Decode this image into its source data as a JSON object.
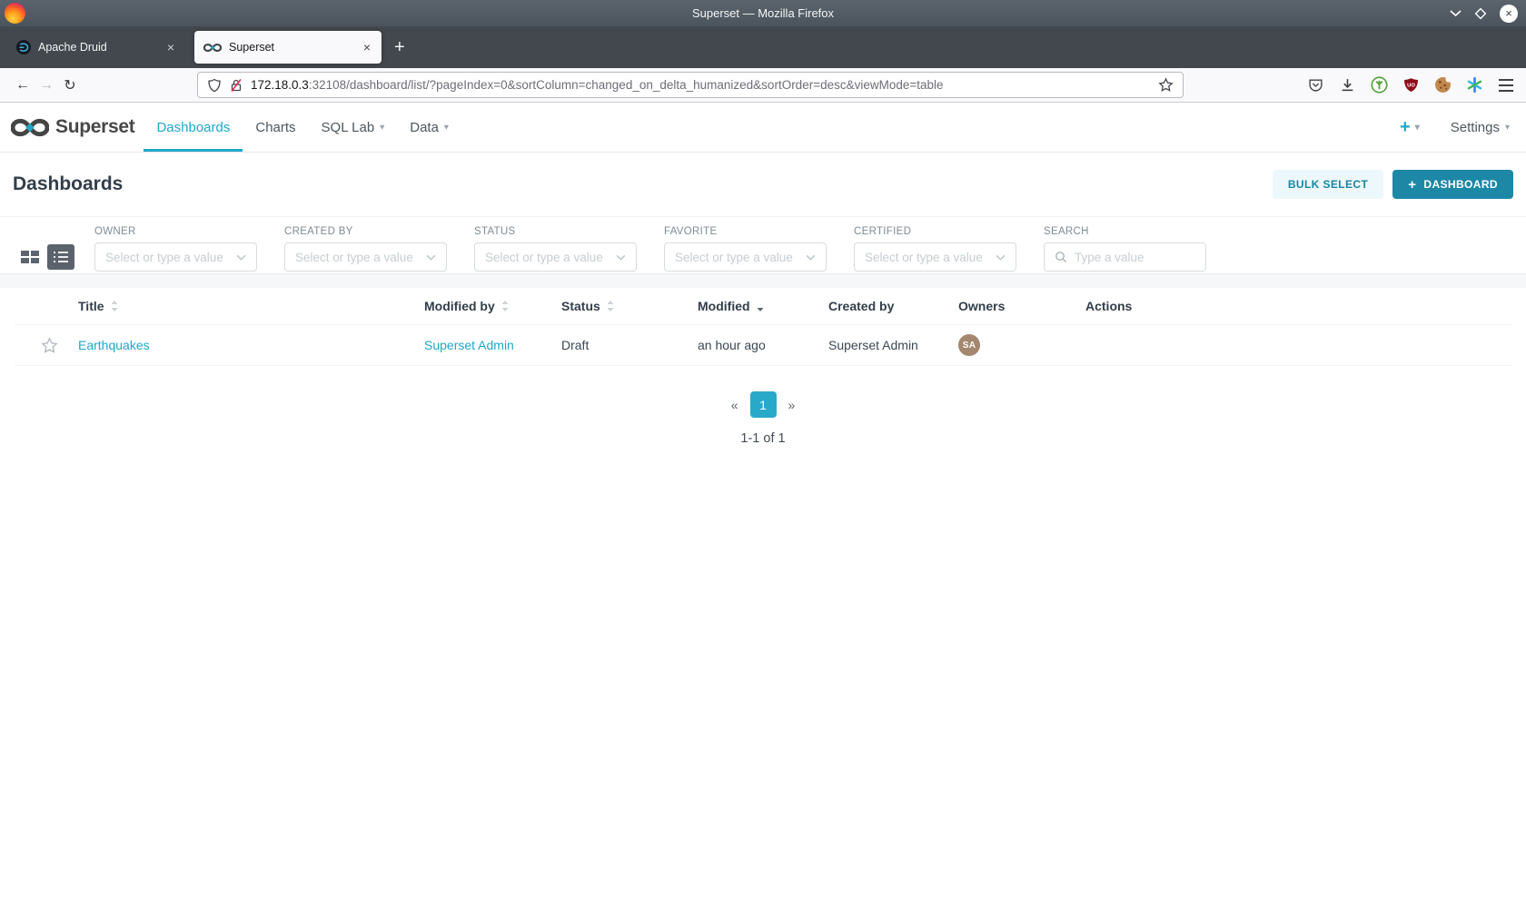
{
  "colors": {
    "accent": "#20a7c9",
    "button_primary": "#1d88a6",
    "avatar": "#a3876e"
  },
  "glyphs": {
    "close": "×",
    "new_tab": "+",
    "back": "←",
    "forward": "→",
    "reload": "↻",
    "caret": "▾",
    "plus": "+",
    "prev": "«",
    "next": "»",
    "ublock": "UO"
  },
  "titlebar": {
    "title": "Superset — Mozilla Firefox"
  },
  "tabs": [
    {
      "label": "Apache Druid"
    },
    {
      "label": "Superset"
    }
  ],
  "urlbar": {
    "host": "172.18.0.3",
    "path": ":32108/dashboard/list/?pageIndex=0&sortColumn=changed_on_delta_humanized&sortOrder=desc&viewMode=table"
  },
  "navbar": {
    "brand": "Superset",
    "items": [
      {
        "label": "Dashboards"
      },
      {
        "label": "Charts"
      },
      {
        "label": "SQL Lab"
      },
      {
        "label": "Data"
      }
    ],
    "plus": "+",
    "settings": "Settings"
  },
  "header": {
    "title": "Dashboards",
    "bulk_select": "BULK SELECT",
    "new_dashboard": "DASHBOARD"
  },
  "filters": [
    {
      "label": "OWNER",
      "placeholder": "Select or type a value"
    },
    {
      "label": "CREATED BY",
      "placeholder": "Select or type a value"
    },
    {
      "label": "STATUS",
      "placeholder": "Select or type a value"
    },
    {
      "label": "FAVORITE",
      "placeholder": "Select or type a value"
    },
    {
      "label": "CERTIFIED",
      "placeholder": "Select or type a value"
    }
  ],
  "search": {
    "label": "SEARCH",
    "placeholder": "Type a value"
  },
  "table": {
    "columns": [
      {
        "label": "Title"
      },
      {
        "label": "Modified by"
      },
      {
        "label": "Status"
      },
      {
        "label": "Modified"
      },
      {
        "label": "Created by"
      },
      {
        "label": "Owners"
      },
      {
        "label": "Actions"
      }
    ],
    "rows": [
      {
        "title": "Earthquakes",
        "modified_by": "Superset Admin",
        "status": "Draft",
        "modified": "an hour ago",
        "created_by": "Superset Admin",
        "owner_initials": "SA"
      }
    ]
  },
  "pagination": {
    "page": "1",
    "summary": "1-1 of 1"
  }
}
